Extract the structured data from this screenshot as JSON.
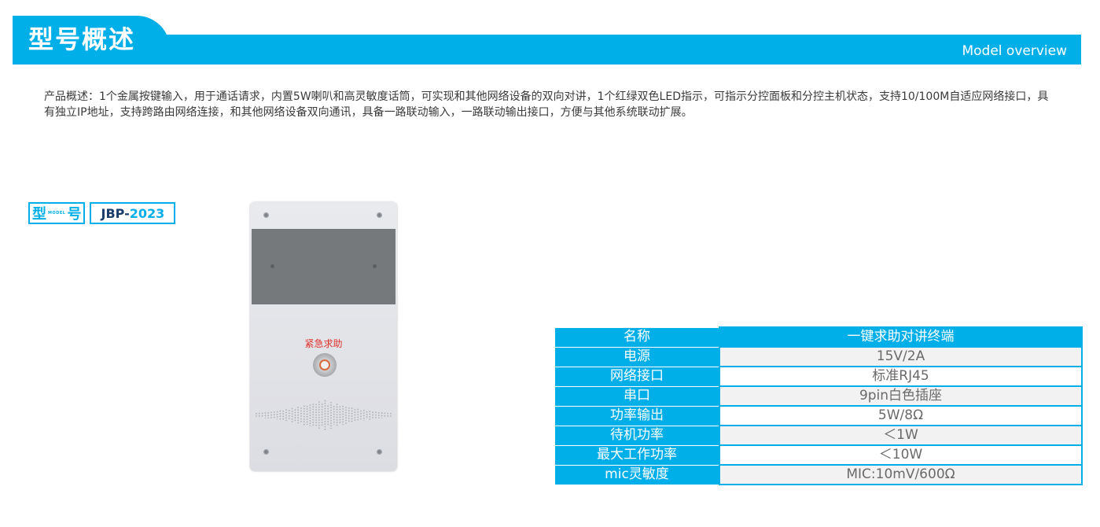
{
  "header": {
    "title": "型号概述",
    "subtitle": "Model overview"
  },
  "description": "产品概述：1个金属按键输入，用于通话请求，内置5W喇叭和高灵敏度话筒，可实现和其他网络设备的双向对讲，1个红绿双色LED指示，可指示分控面板和分控主机状态，支持10/100M自适应网络接口，具有独立IP地址，支持跨路由网络连接，和其他网络设备双向通讯，具备一路联动输入，一路联动输出接口，方便与其他系统联动扩展。",
  "model": {
    "char1": "型",
    "small": "MODEL",
    "char2": "号",
    "prefix": "JBP-",
    "number": "2023"
  },
  "device": {
    "button_label": "紧急求助"
  },
  "specs": {
    "rows": [
      {
        "key": "名称",
        "value": "一键求助对讲终端"
      },
      {
        "key": "电源",
        "value": "15V/2A"
      },
      {
        "key": "网络接口",
        "value": "标准RJ45"
      },
      {
        "key": "串口",
        "value": "9pin白色插座"
      },
      {
        "key": "功率输出",
        "value": "5W/8Ω"
      },
      {
        "key": "待机功率",
        "value": "＜1W"
      },
      {
        "key": "最大工作功率",
        "value": "＜10W"
      },
      {
        "key": "mic灵敏度",
        "value": "MIC:10mV/600Ω"
      }
    ]
  },
  "colors": {
    "accent": "#00aee8",
    "alert": "#e0302a"
  }
}
